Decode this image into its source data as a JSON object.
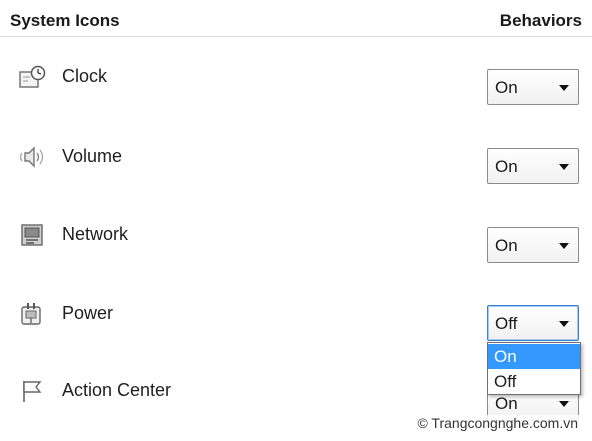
{
  "header": {
    "left_title": "System Icons",
    "right_title": "Behaviors"
  },
  "rows": [
    {
      "label": "Clock",
      "icon": "clock-icon",
      "value": "On"
    },
    {
      "label": "Volume",
      "icon": "speaker-icon",
      "value": "On"
    },
    {
      "label": "Network",
      "icon": "network-icon",
      "value": "On"
    },
    {
      "label": "Power",
      "icon": "power-plug-icon",
      "value": "Off"
    },
    {
      "label": "Action Center",
      "icon": "flag-icon",
      "value": "On"
    }
  ],
  "dropdown": {
    "options": [
      "On",
      "Off"
    ],
    "highlighted": "On"
  },
  "colors": {
    "highlight": "#3399ff",
    "focus_border": "#3a7fd0"
  },
  "watermark": "© Trangcongnghe.com.vn"
}
